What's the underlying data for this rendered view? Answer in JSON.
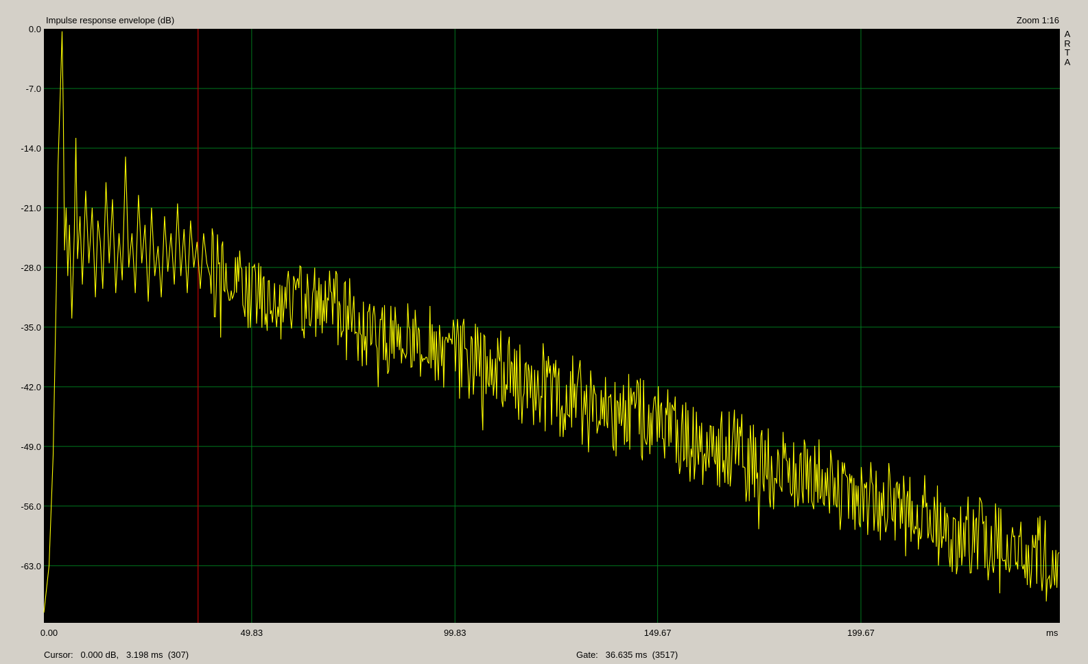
{
  "window": {
    "title": "Impulse response envelope (dB)",
    "zoom": "Zoom 1:16",
    "brand_letters": [
      "A",
      "R",
      "T",
      "A"
    ]
  },
  "status": {
    "cursor_label": "Cursor:",
    "cursor_db": "0.000 dB,",
    "cursor_ms": "3.198 ms",
    "cursor_sample": "(307)",
    "gate_label": "Gate:",
    "gate_ms": "36.635 ms",
    "gate_sample": "(3517)"
  },
  "colors": {
    "plot_bg": "#000000",
    "grid": "#00781e",
    "trace": "#ffff00",
    "marker": "#b40000",
    "window_bg": "#d4d0c8"
  },
  "chart_data": {
    "type": "line",
    "title": "Impulse response envelope (dB)",
    "xlabel": "ms",
    "ylabel": "",
    "xlim": [
      -1.27,
      248.6
    ],
    "ylim": [
      -69.7,
      0
    ],
    "yticks": [
      "0.0",
      "-7.0",
      "-14.0",
      "-21.0",
      "-28.0",
      "-35.0",
      "-42.0",
      "-49.0",
      "-56.0",
      "-63.0"
    ],
    "ytick_values": [
      0,
      -7,
      -14,
      -21,
      -28,
      -35,
      -42,
      -49,
      -56,
      -63
    ],
    "xticks": [
      "0.00",
      "49.83",
      "99.83",
      "149.67",
      "199.67"
    ],
    "xtick_values": [
      0.0,
      49.83,
      99.83,
      149.67,
      199.67
    ],
    "grid": true,
    "cursor_ms": 3.198,
    "gate_ms": 36.635,
    "series": [
      {
        "x": [
          -1.27,
          0.0,
          1.0,
          1.8,
          2.2,
          2.8,
          3.2,
          3.5,
          3.8,
          4.2,
          4.6,
          5.0,
          5.6,
          6.2,
          6.6,
          7.0,
          7.6,
          8.2,
          9.0,
          9.8,
          10.6,
          11.4,
          12.0,
          12.6,
          13.2,
          14.0,
          14.8,
          15.6,
          16.4,
          17.2,
          18.0,
          18.8,
          19.6,
          20.4,
          21.2,
          22.0,
          22.8,
          23.6,
          24.4,
          25.2,
          26.0,
          26.8,
          27.6,
          28.4,
          29.2,
          30.0,
          30.8,
          31.6,
          32.4,
          33.2,
          34.0,
          34.8,
          35.6,
          36.4,
          37.2,
          38.0,
          38.8,
          39.6
        ],
        "y": [
          -68.5,
          -63.0,
          -50.0,
          -30.0,
          -16.0,
          -7.0,
          -0.3,
          -10.0,
          -26.0,
          -21.0,
          -29.0,
          -23.0,
          -34.0,
          -24.0,
          -12.8,
          -27.0,
          -22.0,
          -30.0,
          -19.0,
          -27.5,
          -21.0,
          -31.5,
          -22.5,
          -25.0,
          -30.5,
          -18.0,
          -27.5,
          -20.0,
          -31.0,
          -24.0,
          -29.5,
          -15.0,
          -28.0,
          -24.0,
          -31.0,
          -19.5,
          -27.5,
          -23.0,
          -32.0,
          -21.0,
          -29.0,
          -25.5,
          -31.5,
          -22.0,
          -28.5,
          -24.0,
          -30.0,
          -20.5,
          -29.0,
          -23.5,
          -31.0,
          -22.5,
          -28.0,
          -25.0,
          -30.5,
          -24.0,
          -27.5,
          -29.0
        ]
      }
    ]
  }
}
